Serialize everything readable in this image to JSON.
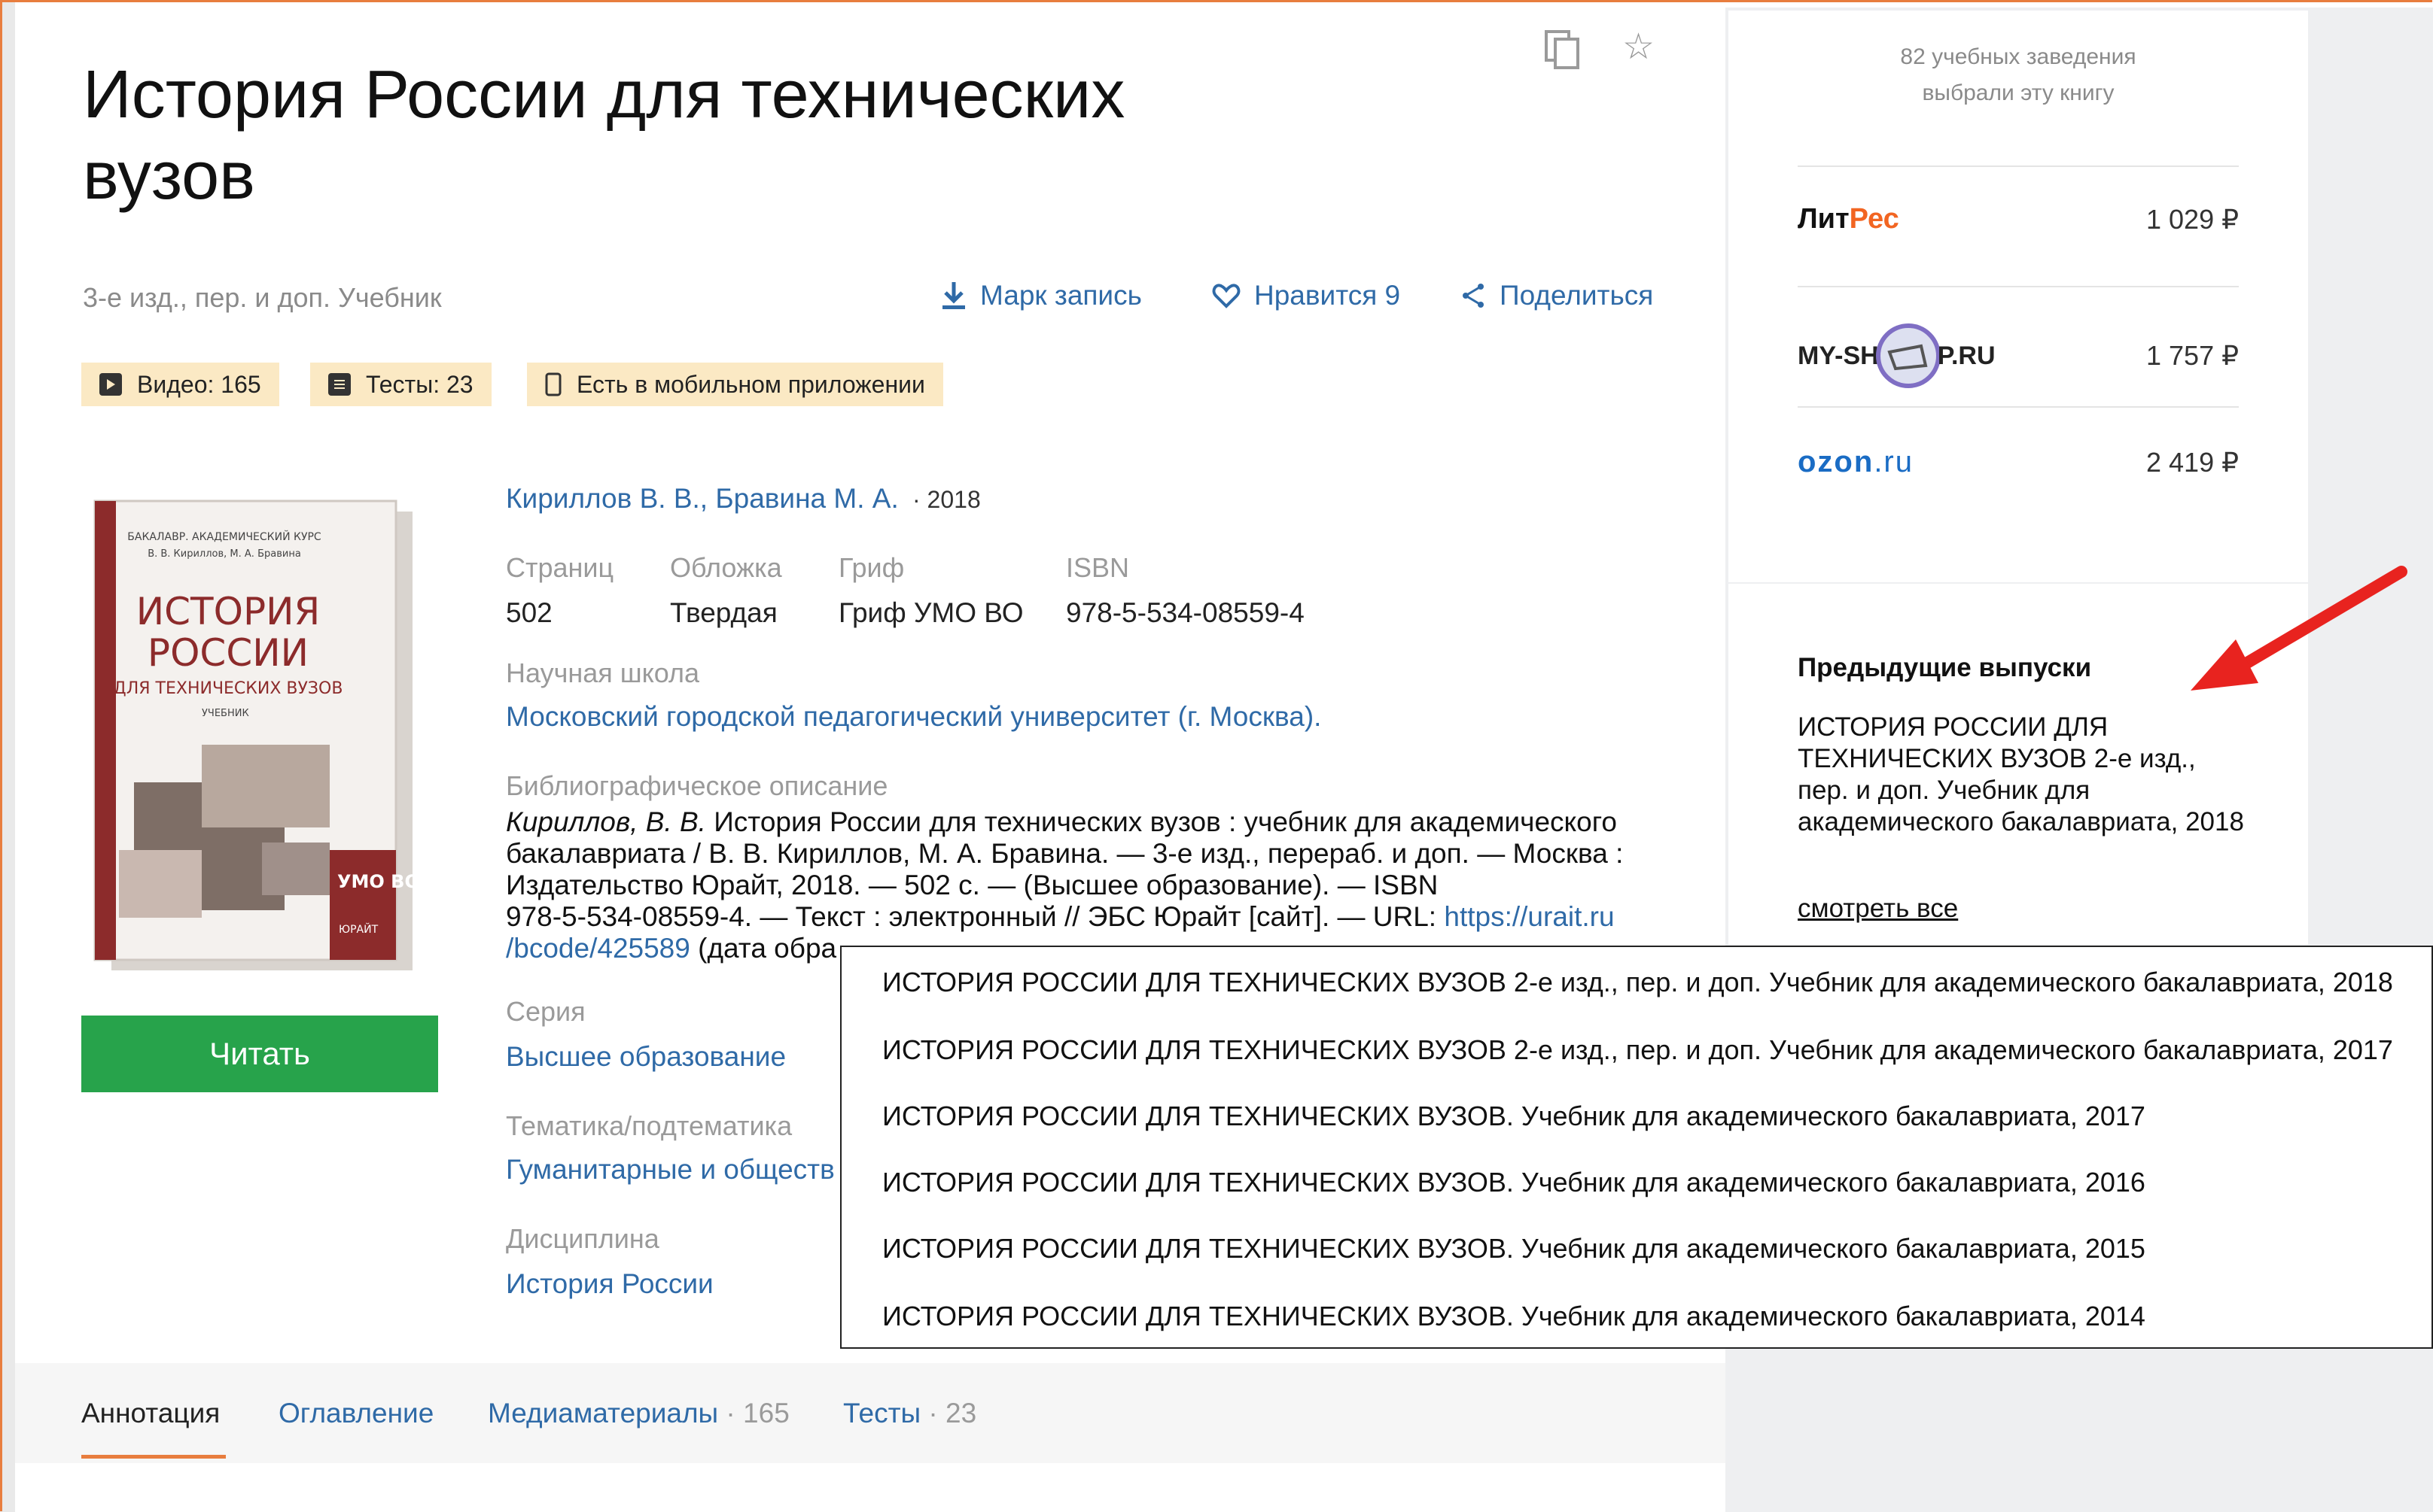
{
  "book": {
    "title": "История России для технических вузов",
    "subtitle": "3-е изд., пер. и доп. Учебник",
    "authors": "Кириллов В. В., Бравина М. А.",
    "year": "· 2018"
  },
  "actions": {
    "bookmark": "Марк запись",
    "likes": "Нравится 9",
    "share": "Поделиться"
  },
  "tags": {
    "video": "Видео: 165",
    "tests": "Тесты: 23",
    "mobile": "Есть в мобильном приложении"
  },
  "cover": {
    "top_line": "БАКАЛАВР. АКАДЕМИЧЕСКИЙ КУРС",
    "authors_line": "В. В. Кириллов, М. А. Бравина",
    "title_line1": "ИСТОРИЯ",
    "title_line2": "РОССИИ",
    "title_line3": "ДЛЯ ТЕХНИЧЕСКИХ ВУЗОВ",
    "kind": "УЧЕБНИК",
    "badge": "УМО ВО",
    "publisher": "ЮРАЙТ"
  },
  "read_button": "Читать",
  "details": {
    "pages_label": "Страниц",
    "pages_value": "502",
    "cover_label": "Обложка",
    "cover_value": "Твердая",
    "grif_label": "Гриф",
    "grif_value": "Гриф УМО ВО",
    "isbn_label": "ISBN",
    "isbn_value": "978-5-534-08559-4",
    "school_label": "Научная школа",
    "school_value": "Московский городской педагогический университет (г. Москва).",
    "biblio_label": "Библиографическое описание",
    "biblio_author": "Кириллов, В. В.",
    "biblio_text1": " История России для технических вузов : учебник для академического",
    "biblio_text2": "бакалавриата / В. В. Кириллов, М. А. Бравина. — 3-е изд., перераб. и доп. — Москва :",
    "biblio_text3": "Издательство Юрайт, 2018. — 502 с. — (Высшее образование). — ISBN",
    "biblio_text4": "978-5-534-08559-4. — Текст : электронный // ЭБС Юрайт [сайт]. — URL: ",
    "biblio_link1": "https://urait.ru",
    "biblio_link2": "/bcode/425589",
    "biblio_text5": " (дата обра",
    "series_label": "Серия",
    "series_value": "Высшее образование",
    "theme_label": "Тематика/подтематика",
    "theme_value": "Гуманитарные и обществ",
    "discipline_label": "Дисциплина",
    "discipline_value": "История России"
  },
  "popup": {
    "items": [
      "ИСТОРИЯ РОССИИ ДЛЯ ТЕХНИЧЕСКИХ ВУЗОВ 2-е изд., пер. и доп. Учебник для академического бакалавриата, 2018",
      "ИСТОРИЯ РОССИИ ДЛЯ ТЕХНИЧЕСКИХ ВУЗОВ 2-е изд., пер. и доп. Учебник для академического бакалавриата, 2017",
      "ИСТОРИЯ РОССИИ ДЛЯ ТЕХНИЧЕСКИХ ВУЗОВ. Учебник для академического бакалавриата, 2017",
      "ИСТОРИЯ РОССИИ ДЛЯ ТЕХНИЧЕСКИХ ВУЗОВ. Учебник для академического бакалавриата, 2016",
      "ИСТОРИЯ РОССИИ ДЛЯ ТЕХНИЧЕСКИХ ВУЗОВ. Учебник для академического бакалавриата, 2015",
      "ИСТОРИЯ РОССИИ ДЛЯ ТЕХНИЧЕСКИХ ВУЗОВ. Учебник для академического бакалавриата, 2014"
    ]
  },
  "tabs": [
    {
      "label": "Аннотация",
      "count": ""
    },
    {
      "label": "Оглавление",
      "count": ""
    },
    {
      "label": "Медиаматериалы",
      "count": " · 165"
    },
    {
      "label": "Тесты",
      "count": " · 23"
    }
  ],
  "sidebar": {
    "chosen_line1": "82 учебных заведения",
    "chosen_line2": "выбрали эту книгу",
    "shops": [
      {
        "name_a": "Лит",
        "name_b": "Рес",
        "price": "1 029 ₽"
      },
      {
        "name_a": "MY-SH",
        "name_b": "P.RU",
        "price": "1 757 ₽"
      },
      {
        "name_a": "ozon",
        "name_b": ".ru",
        "price": "2 419 ₽"
      }
    ],
    "prev_title": "Предыдущие выпуски",
    "prev_item": "ИСТОРИЯ РОССИИ ДЛЯ ТЕХНИЧЕСКИХ ВУЗОВ 2-е изд., пер. и доп. Учебник для академического бакалавриата, 2018",
    "see_all": "смотреть все"
  },
  "colors": {
    "accent": "#e87d3e",
    "link": "#2f6aa7",
    "read_button": "#27a34b",
    "tag_bg": "#fbe9c4",
    "arrow": "#e8231f"
  }
}
